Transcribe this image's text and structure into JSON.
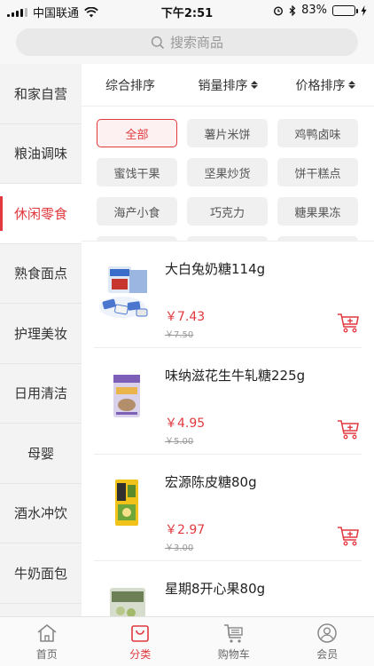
{
  "status_bar": {
    "carrier": "中国联通",
    "time": "下午2:51",
    "battery": "83%",
    "battery_level": 0.83
  },
  "search": {
    "placeholder": "搜索商品"
  },
  "sidebar": {
    "items": [
      {
        "label": "和家自营",
        "active": false
      },
      {
        "label": "粮油调味",
        "active": false
      },
      {
        "label": "休闲零食",
        "active": true
      },
      {
        "label": "熟食面点",
        "active": false
      },
      {
        "label": "护理美妆",
        "active": false
      },
      {
        "label": "日用清洁",
        "active": false
      },
      {
        "label": "母婴",
        "active": false
      },
      {
        "label": "酒水冲饮",
        "active": false
      },
      {
        "label": "牛奶面包",
        "active": false
      }
    ]
  },
  "sort_bar": {
    "comprehensive": "综合排序",
    "sales": "销量排序",
    "price": "价格排序"
  },
  "chips": [
    "全部",
    "薯片米饼",
    "鸡鸭卤味",
    "蜜饯干果",
    "坚果炒货",
    "饼干糕点",
    "海产小食",
    "巧克力",
    "糖果果冻"
  ],
  "products": [
    {
      "name": "大白兔奶糖114g",
      "price": "￥7.43",
      "old_price": "￥7.50"
    },
    {
      "name": "味纳滋花生牛轧糖225g",
      "price": "￥4.95",
      "old_price": "￥5.00"
    },
    {
      "name": "宏源陈皮糖80g",
      "price": "￥2.97",
      "old_price": "￥3.00"
    },
    {
      "name": "星期8开心果80g",
      "price": "",
      "old_price": ""
    }
  ],
  "tab_bar": {
    "home": "首页",
    "category": "分类",
    "cart": "购物车",
    "member": "会员"
  },
  "colors": {
    "accent": "#e0393e",
    "sidebar_bg": "#f3f3f3",
    "battery": "#3cc83c"
  }
}
